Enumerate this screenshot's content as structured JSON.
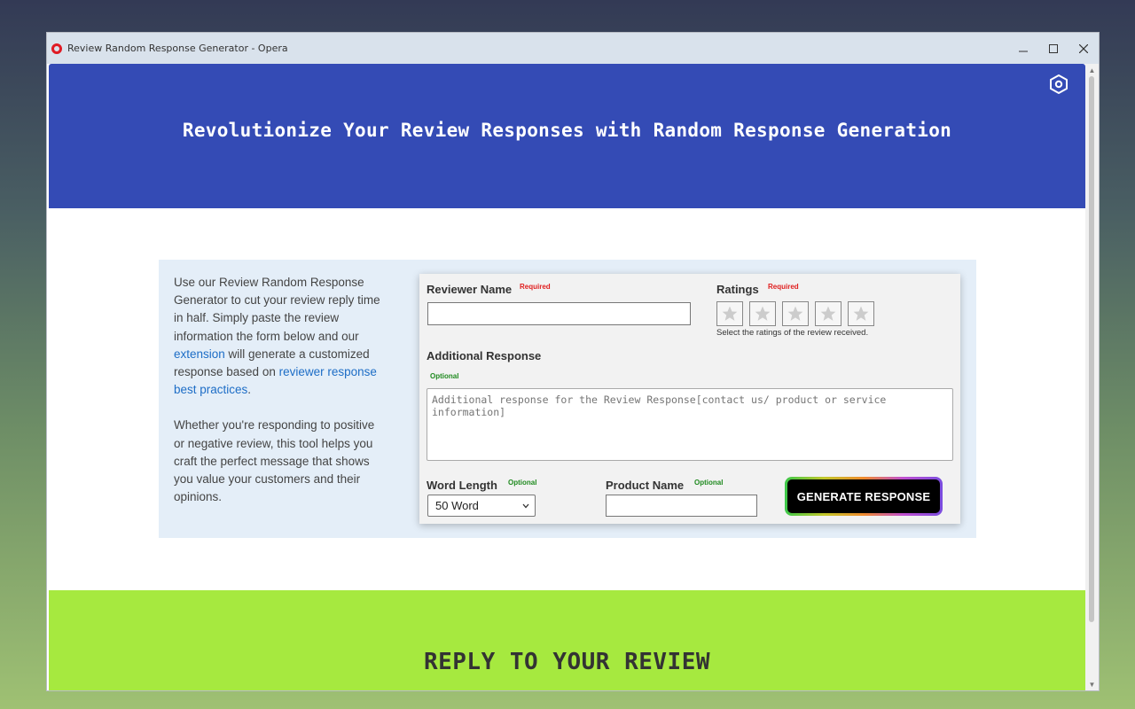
{
  "window": {
    "title": "Review Random Response Generator - Opera",
    "controls": [
      "minimize",
      "maximize",
      "close"
    ]
  },
  "hero": {
    "title": "Revolutionize Your Review Responses with Random Response Generation",
    "settings_icon": "gear-icon"
  },
  "intro": {
    "p1_a": "Use our Review Random Response Generator to cut your review reply time in half. Simply paste the review information the form below and our ",
    "p1_link1": "extension",
    "p1_b": " will generate a customized response based on ",
    "p1_link2": "reviewer response best practices",
    "p1_c": ".",
    "p2": "Whether you're responding to positive or negative review, this tool helps you craft the perfect message that shows you value your customers and their opinions."
  },
  "form": {
    "reviewer_name_label": "Reviewer Name",
    "reviewer_name_tag": "Required",
    "reviewer_name_value": "",
    "ratings_label": "Ratings",
    "ratings_tag": "Required",
    "ratings_hint": "Select the ratings of the review received.",
    "rating_value": 0,
    "rating_max": 5,
    "additional_label": "Additional Response",
    "additional_tag": "Optional",
    "additional_placeholder": "Additional response for the Review Response[contact us/ product or service information]",
    "word_length_label": "Word Length",
    "word_length_tag": "Optional",
    "word_length_value": "50 Word",
    "product_name_label": "Product Name",
    "product_name_tag": "Optional",
    "product_name_value": "",
    "generate_button": "GENERATE RESPONSE"
  },
  "footer": {
    "title": "REPLY TO YOUR REVIEW"
  },
  "colors": {
    "hero_bg": "#344bb5",
    "content_bg": "#e4eef8",
    "footer_bg": "#a6e93f",
    "required": "#e02020",
    "optional": "#1f8a1f",
    "link": "#1d6dc6"
  }
}
